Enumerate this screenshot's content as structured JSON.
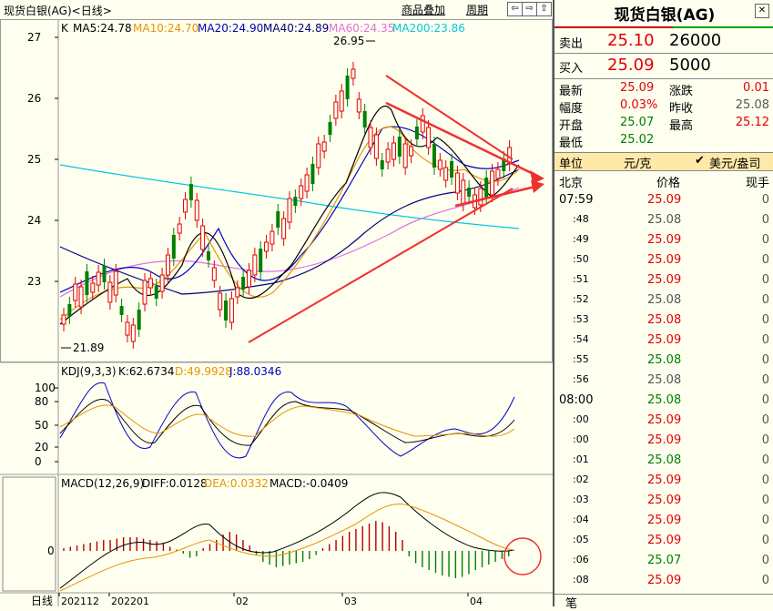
{
  "header": {
    "title": "现货白银(AG)<日线>",
    "btn_overlay": "商品叠加",
    "btn_period": "周期",
    "nav_left": "⇦",
    "nav_right": "⇨",
    "nav_up": "⇧"
  },
  "main_chart": {
    "k_label": "K",
    "ma5": "MA5:24.78",
    "ma10": "MA10:24.70",
    "ma20": "MA20:24.90",
    "ma40": "MA40:24.89",
    "ma60": "MA60:24.35",
    "ma200": "MA200:23.86",
    "high_label": "26.95",
    "low_label": "21.89",
    "y_ticks": [
      "27",
      "26",
      "25",
      "24",
      "23"
    ]
  },
  "kdj": {
    "label": "KDJ(9,3,3)",
    "k": "K:62.6734",
    "d": "D:49.9928",
    "j": "J:88.0346",
    "y_ticks": [
      "100",
      "80",
      "50",
      "20",
      "0"
    ]
  },
  "macd": {
    "label": "MACD(12,26,9)",
    "diff": "DIFF:0.0128",
    "dea": "DEA:0.0332",
    "macd": "MACD:-0.0409",
    "zero": "0"
  },
  "x_axis": {
    "period": "日线",
    "labels": [
      "202112",
      "202201",
      "02",
      "03",
      "04"
    ]
  },
  "quote": {
    "title": "现货白银(AG)",
    "sell_label": "卖出",
    "sell_price": "25.10",
    "sell_vol": "26000",
    "buy_label": "买入",
    "buy_price": "25.09",
    "buy_vol": "5000",
    "latest_label": "最新",
    "latest": "25.09",
    "change_label": "涨跌",
    "change": "0.01",
    "amp_label": "幅度",
    "amp": "0.03%",
    "prev_label": "昨收",
    "prev": "25.08",
    "open_label": "开盘",
    "open": "25.07",
    "high_label": "最高",
    "high": "25.12",
    "low_label": "最低",
    "low": "25.02",
    "unit_label": "单位",
    "unit": "元/克",
    "unit_check": "✔",
    "unit_alt": "美元/盎司",
    "col_time": "北京",
    "col_price": "价格",
    "col_vol": "现手",
    "footer": "笔"
  },
  "ticks": [
    {
      "t": "07:59",
      "p": "25.09",
      "v": "0",
      "c": "red"
    },
    {
      "t": ":48",
      "p": "25.08",
      "v": "0",
      "c": "gray"
    },
    {
      "t": ":49",
      "p": "25.09",
      "v": "0",
      "c": "red"
    },
    {
      "t": ":50",
      "p": "25.09",
      "v": "0",
      "c": "red"
    },
    {
      "t": ":51",
      "p": "25.09",
      "v": "0",
      "c": "red"
    },
    {
      "t": ":52",
      "p": "25.08",
      "v": "0",
      "c": "gray"
    },
    {
      "t": ":53",
      "p": "25.08",
      "v": "0",
      "c": "red"
    },
    {
      "t": ":54",
      "p": "25.09",
      "v": "0",
      "c": "red"
    },
    {
      "t": ":55",
      "p": "25.08",
      "v": "0",
      "c": "green"
    },
    {
      "t": ":56",
      "p": "25.08",
      "v": "0",
      "c": "gray"
    },
    {
      "t": "08:00",
      "p": "25.08",
      "v": "0",
      "c": "green"
    },
    {
      "t": ":00",
      "p": "25.09",
      "v": "0",
      "c": "red"
    },
    {
      "t": ":00",
      "p": "25.09",
      "v": "0",
      "c": "red"
    },
    {
      "t": ":01",
      "p": "25.08",
      "v": "0",
      "c": "green"
    },
    {
      "t": ":02",
      "p": "25.09",
      "v": "0",
      "c": "red"
    },
    {
      "t": ":03",
      "p": "25.09",
      "v": "0",
      "c": "red"
    },
    {
      "t": ":04",
      "p": "25.09",
      "v": "0",
      "c": "red"
    },
    {
      "t": ":05",
      "p": "25.09",
      "v": "0",
      "c": "red"
    },
    {
      "t": ":06",
      "p": "25.07",
      "v": "0",
      "c": "green"
    },
    {
      "t": ":08",
      "p": "25.09",
      "v": "0",
      "c": "red"
    }
  ],
  "colors": {
    "up": "#e00000",
    "down": "#008000",
    "ma5": "#000000",
    "ma10": "#e69500",
    "ma20": "#0000c0",
    "ma40": "#000080",
    "ma60": "#e070e0",
    "ma200": "#00c8e0",
    "trendline": "#ee3030"
  }
}
